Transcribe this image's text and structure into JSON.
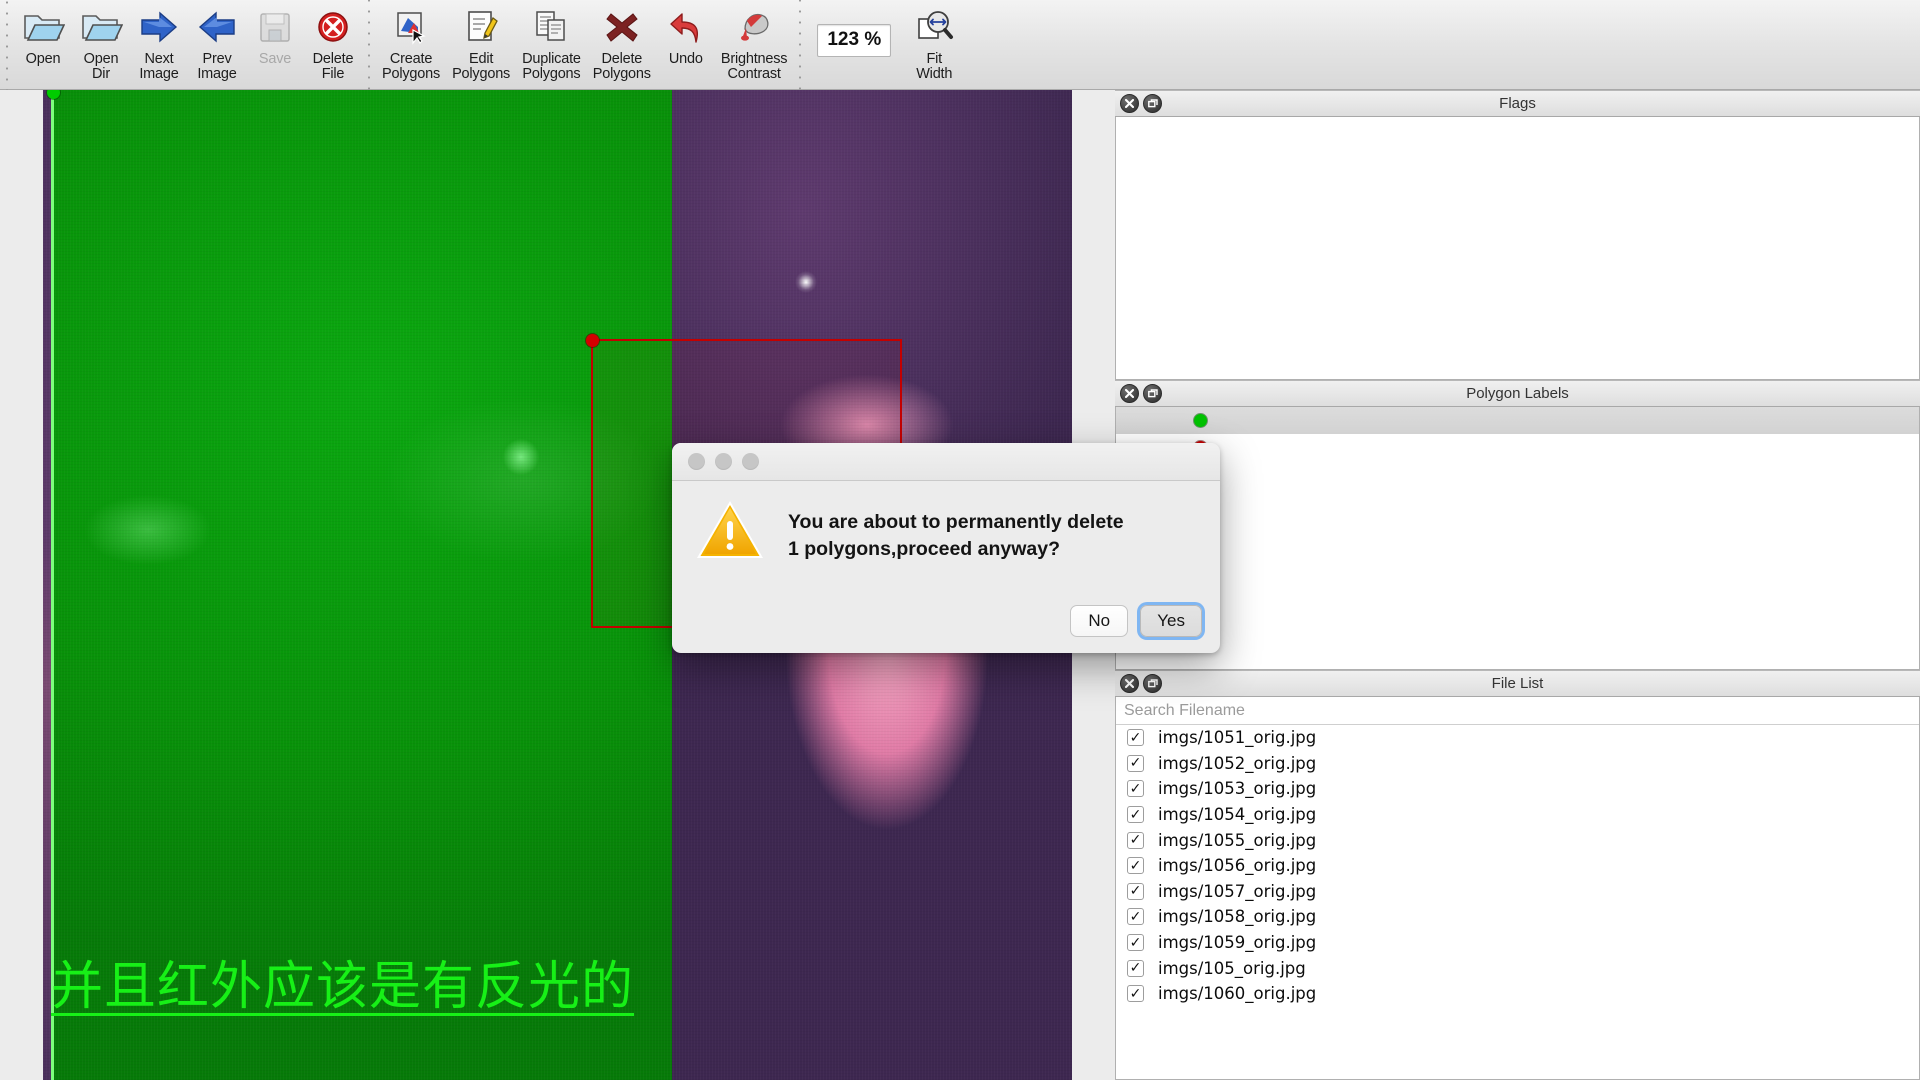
{
  "toolbar": {
    "items": [
      {
        "label": "Open",
        "icon": "open-folder-icon",
        "enabled": true
      },
      {
        "label": "Open\nDir",
        "icon": "open-dir-folder-icon",
        "enabled": true
      },
      {
        "label": "Next\nImage",
        "icon": "arrow-right-icon",
        "enabled": true
      },
      {
        "label": "Prev\nImage",
        "icon": "arrow-left-icon",
        "enabled": true
      },
      {
        "label": "Save",
        "icon": "floppy-disk-icon",
        "enabled": false
      },
      {
        "label": "Delete\nFile",
        "icon": "delete-circle-icon",
        "enabled": true
      },
      {
        "label": "Create\nPolygons",
        "icon": "create-polygon-icon",
        "enabled": true
      },
      {
        "label": "Edit\nPolygons",
        "icon": "edit-pencil-icon",
        "enabled": true
      },
      {
        "label": "Duplicate\nPolygons",
        "icon": "duplicate-pages-icon",
        "enabled": true
      },
      {
        "label": "Delete\nPolygons",
        "icon": "x-cross-icon",
        "enabled": true
      },
      {
        "label": "Undo",
        "icon": "undo-arrow-icon",
        "enabled": true
      },
      {
        "label": "Brightness\nContrast",
        "icon": "brightness-contrast-icon",
        "enabled": true
      }
    ],
    "zoom_value": "123 %",
    "fit_width_label": "Fit\nWidth",
    "fit_width_icon": "fit-width-magnifier-icon"
  },
  "canvas": {
    "annotation_text": "并且红外应该是有反光的",
    "annotation_color": "#17f017",
    "selected_polygon_color": "#c40000",
    "vertex_green_color": "#00cc00",
    "vertex_red_color": "#d40000"
  },
  "flags_panel": {
    "title": "Flags",
    "close_icon": "close-icon",
    "float_icon": "undock-icon",
    "items": []
  },
  "polygon_labels_panel": {
    "title": "Polygon Labels",
    "close_icon": "close-icon",
    "float_icon": "undock-icon",
    "rows": [
      {
        "dot": "green",
        "label": "",
        "selected": true
      },
      {
        "dot": "red",
        "label": "",
        "selected": false
      }
    ]
  },
  "file_list_panel": {
    "title": "File List",
    "close_icon": "close-icon",
    "float_icon": "undock-icon",
    "search_placeholder": "Search Filename",
    "search_value": "",
    "files": [
      {
        "name": "imgs/1051_orig.jpg",
        "checked": true
      },
      {
        "name": "imgs/1052_orig.jpg",
        "checked": true
      },
      {
        "name": "imgs/1053_orig.jpg",
        "checked": true
      },
      {
        "name": "imgs/1054_orig.jpg",
        "checked": true
      },
      {
        "name": "imgs/1055_orig.jpg",
        "checked": true
      },
      {
        "name": "imgs/1056_orig.jpg",
        "checked": true
      },
      {
        "name": "imgs/1057_orig.jpg",
        "checked": true
      },
      {
        "name": "imgs/1058_orig.jpg",
        "checked": true
      },
      {
        "name": "imgs/1059_orig.jpg",
        "checked": true
      },
      {
        "name": "imgs/105_orig.jpg",
        "checked": true
      },
      {
        "name": "imgs/1060_orig.jpg",
        "checked": true
      }
    ],
    "check_glyph": "✓"
  },
  "dialog": {
    "message": "You are about to permanently delete 1 polygons,proceed anyway?",
    "warning_icon": "warning-triangle-icon",
    "buttons": [
      {
        "label": "No",
        "default": false
      },
      {
        "label": "Yes",
        "default": true
      }
    ],
    "accent_focus_color": "#7fb6f2"
  }
}
